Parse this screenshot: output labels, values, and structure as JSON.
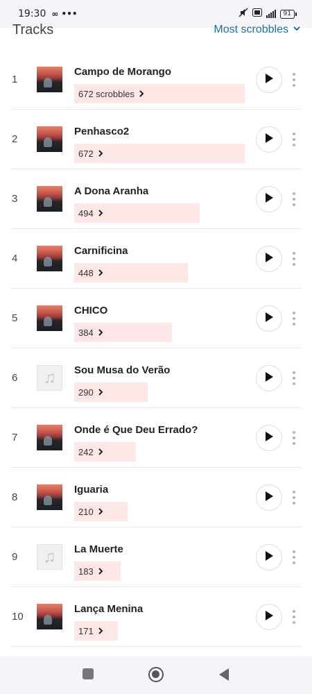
{
  "status_bar": {
    "time": "19:30",
    "extra": "∞ •••",
    "battery": "91"
  },
  "header": {
    "title": "Tracks",
    "sort_label": "Most scrobbles"
  },
  "tracks": [
    {
      "rank": "1",
      "name": "Campo de Morango",
      "scrobbles": "672 scrobbles",
      "count": 672,
      "art": "photo"
    },
    {
      "rank": "2",
      "name": "Penhasco2",
      "scrobbles": "672",
      "count": 672,
      "art": "photo"
    },
    {
      "rank": "3",
      "name": "A Dona Aranha",
      "scrobbles": "494",
      "count": 494,
      "art": "photo"
    },
    {
      "rank": "4",
      "name": "Carnificina",
      "scrobbles": "448",
      "count": 448,
      "art": "photo"
    },
    {
      "rank": "5",
      "name": "CHICO",
      "scrobbles": "384",
      "count": 384,
      "art": "photo"
    },
    {
      "rank": "6",
      "name": "Sou Musa do Verão",
      "scrobbles": "290",
      "count": 290,
      "art": "placeholder"
    },
    {
      "rank": "7",
      "name": "Onde é Que Deu Errado?",
      "scrobbles": "242",
      "count": 242,
      "art": "photo"
    },
    {
      "rank": "8",
      "name": "Iguaria",
      "scrobbles": "210",
      "count": 210,
      "art": "photo"
    },
    {
      "rank": "9",
      "name": "La Muerte",
      "scrobbles": "183",
      "count": 183,
      "art": "placeholder"
    },
    {
      "rank": "10",
      "name": "Lança Menina",
      "scrobbles": "171",
      "count": 171,
      "art": "photo"
    }
  ],
  "icons": {
    "sort": "chevron-down-icon",
    "play": "play-icon",
    "more": "more-vertical-icon",
    "placeholder_art": "music-note-icon"
  },
  "colors": {
    "accent": "#1d6e99",
    "bar": "#fde6e6"
  }
}
